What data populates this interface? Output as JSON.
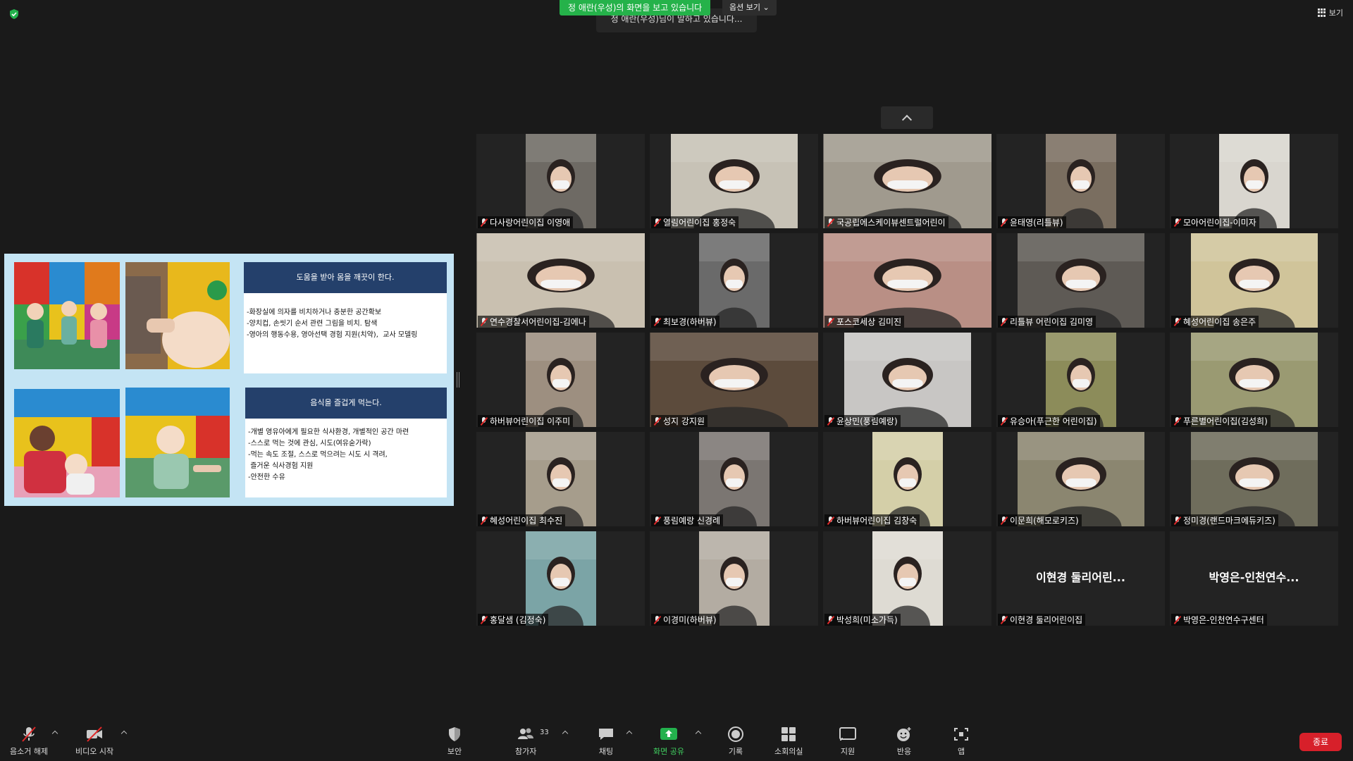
{
  "topbar": {
    "share_banner": "정 애란(우성)의 화면을 보고 있습니다",
    "view_options": "옵션 보기 ⌄",
    "toast": "정 애란(우성)님이 말하고 있습니다...",
    "view_button": "보기"
  },
  "shared_slide": {
    "box1_title": "도움을 받아 몸을 깨끗이 한다.",
    "box1_body": "-화장실에 의자를 비치하거나 충분한 공간확보\n-양치컵, 손씻기 순서 관련 그림을 비치. 탐색\n-영아의 행동수용, 영아선택 경험 지원(치약),  교사 모델링",
    "box2_title": "음식을 즐겁게 먹는다.",
    "box2_body": "-개별 영유아에게 필요한 식사환경, 개별적인 공간 마련\n-스스로 먹는 것에 관심, 시도(여유숟가락)\n-먹는 속도 조절, 스스로 먹으려는 시도 시 격려,\n 즐거운 식사경험 지원\n-안전한 수유"
  },
  "participants": [
    {
      "name": "다사랑어린이집 이영애",
      "video": true,
      "bg": "#6e6a64",
      "vw": 100
    },
    {
      "name": "열림어린이집 홍정숙",
      "video": true,
      "bg": "#c7c2b6",
      "vw": 180
    },
    {
      "name": "국공립에스케이뷰센트럴어린이",
      "video": true,
      "bg": "#a09a8e",
      "vw": 239
    },
    {
      "name": "윤태영(리틀뷰)",
      "video": true,
      "bg": "#7a6e60",
      "vw": 100
    },
    {
      "name": "모아어린이집-이미자",
      "video": true,
      "bg": "#d9d6cf",
      "vw": 100
    },
    {
      "name": "연수경찰서어린이집-김에나",
      "video": true,
      "bg": "#c9c0b0",
      "vw": 239
    },
    {
      "name": "최보경(하버뷰)",
      "video": true,
      "bg": "#6a6a6a",
      "vw": 100
    },
    {
      "name": "포스코세상 김미진",
      "video": true,
      "bg": "#b98f85",
      "vw": 239
    },
    {
      "name": "리틀뷰 어린이집 김미영",
      "video": true,
      "bg": "#5e5a55",
      "vw": 180
    },
    {
      "name": "혜성어린이집  송은주",
      "video": true,
      "bg": "#d0c49a",
      "vw": 180
    },
    {
      "name": "하버뷰어린이집 이주미",
      "video": true,
      "bg": "#9d8f80",
      "vw": 100
    },
    {
      "name": "성지 강지원",
      "video": true,
      "bg": "#5c4b3c",
      "vw": 239
    },
    {
      "name": "윤상민(풍림예랑)",
      "video": true,
      "bg": "#c8c6c4",
      "vw": 180
    },
    {
      "name": "유승아(푸근한 어린이집)",
      "video": true,
      "bg": "#8c8c5a",
      "vw": 100
    },
    {
      "name": "푸른별어린이집(김성희)",
      "video": true,
      "bg": "#9a9a72",
      "vw": 180
    },
    {
      "name": "혜성어린이집 최수진",
      "video": true,
      "bg": "#a69d8c",
      "vw": 100
    },
    {
      "name": "풍림예랑 신경례",
      "video": true,
      "bg": "#7b7672",
      "vw": 100
    },
    {
      "name": "하버뷰어린이집 김창숙",
      "video": true,
      "bg": "#d4cfa8",
      "vw": 100
    },
    {
      "name": "이문희(해모로키즈)",
      "video": true,
      "bg": "#8b8670",
      "vw": 180
    },
    {
      "name": "정미경(랜드마크에듀키즈)",
      "video": true,
      "bg": "#6f6d5c",
      "vw": 180
    },
    {
      "name": "홍달샘 (김정숙)",
      "video": true,
      "bg": "#7ba4a6",
      "vw": 100
    },
    {
      "name": "이경미(하버뷰)",
      "video": true,
      "bg": "#b3aca2",
      "vw": 100
    },
    {
      "name": "박성희(미소가득)",
      "video": true,
      "bg": "#dedbd3",
      "vw": 100
    },
    {
      "name": "이현경 둘리어린이집",
      "video": false,
      "big": "이현경 둘리어린..."
    },
    {
      "name": "박영은-인천연수구센터",
      "video": false,
      "big": "박영은-인천연수..."
    }
  ],
  "toolbar": {
    "unmute": "음소거 해제",
    "start_video": "비디오 시작",
    "security": "보안",
    "participants": "참가자",
    "participant_count": "33",
    "chat": "채팅",
    "share_screen": "화면 공유",
    "record": "기록",
    "breakout": "소회의실",
    "support": "지원",
    "reactions": "반응",
    "apps": "앱",
    "end": "종료"
  },
  "colors": {
    "background": "#1a1a1a",
    "share_green": "#25b24a",
    "end_red": "#d7202a",
    "slide_header": "#24406b",
    "slide_bg": "#c4e4f4"
  }
}
